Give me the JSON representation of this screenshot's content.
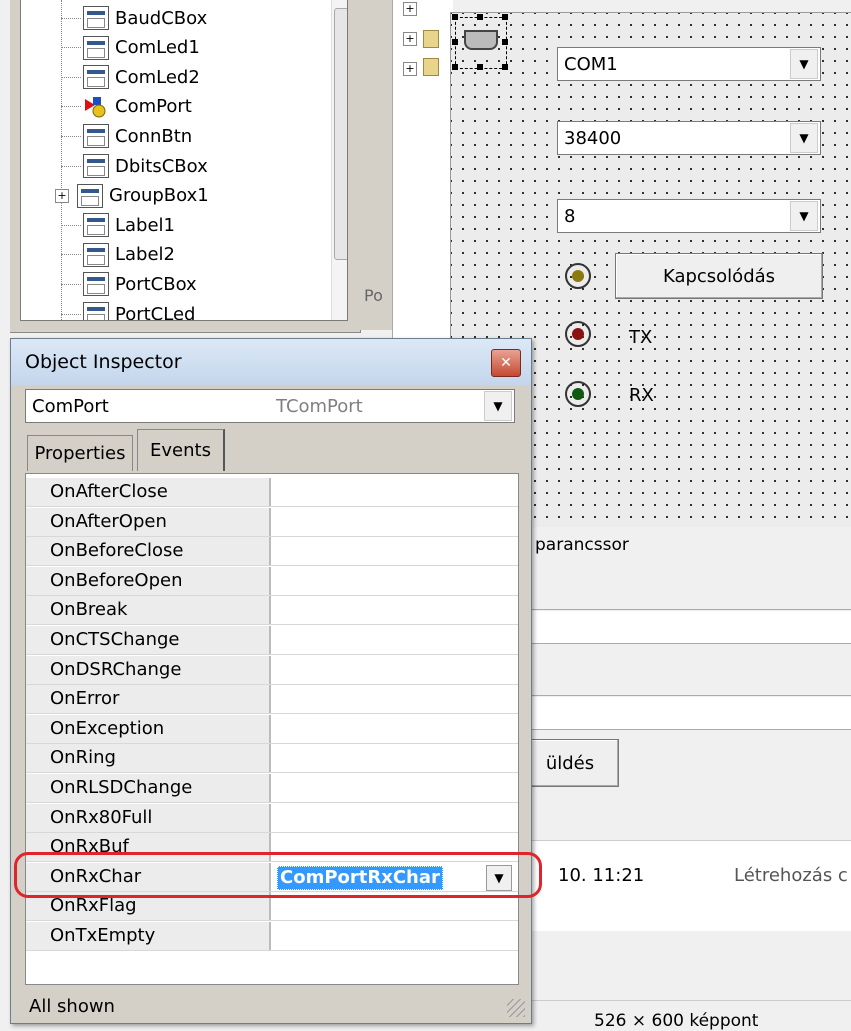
{
  "tree": {
    "items": [
      {
        "label": "BaudCBox",
        "type": "component"
      },
      {
        "label": "ComLed1",
        "type": "component"
      },
      {
        "label": "ComLed2",
        "type": "component"
      },
      {
        "label": "ComPort",
        "type": "comport"
      },
      {
        "label": "ConnBtn",
        "type": "component"
      },
      {
        "label": "DbitsCBox",
        "type": "component"
      },
      {
        "label": "GroupBox1",
        "type": "group",
        "expandable": true
      },
      {
        "label": "Label1",
        "type": "component"
      },
      {
        "label": "Label2",
        "type": "component"
      },
      {
        "label": "PortCBox",
        "type": "component"
      },
      {
        "label": "PortCLed",
        "type": "component"
      }
    ]
  },
  "mid_strip": {
    "partial_label": "Po"
  },
  "designer": {
    "port_combo": "COM1",
    "baud_combo": "38400",
    "bits_combo": "8",
    "connect_button": "Kapcsolódás",
    "tx_label": "TX",
    "rx_label": "RX",
    "partial_caption": "parancssor",
    "send_button_partial": "üldés"
  },
  "file_list": {
    "date_partial": "10. 11:21",
    "type_partial": "Létrehozás c"
  },
  "statusbar": {
    "size_partial": "526 × 600 képpont"
  },
  "object_inspector": {
    "title": "Object Inspector",
    "close_glyph": "✕",
    "selected_component": "ComPort",
    "selected_type": "TComPort",
    "tabs": [
      {
        "label": "Properties",
        "active": false
      },
      {
        "label": "Events",
        "active": true
      }
    ],
    "events": [
      {
        "name": "OnAfterClose",
        "value": ""
      },
      {
        "name": "OnAfterOpen",
        "value": ""
      },
      {
        "name": "OnBeforeClose",
        "value": ""
      },
      {
        "name": "OnBeforeOpen",
        "value": ""
      },
      {
        "name": "OnBreak",
        "value": ""
      },
      {
        "name": "OnCTSChange",
        "value": ""
      },
      {
        "name": "OnDSRChange",
        "value": ""
      },
      {
        "name": "OnError",
        "value": ""
      },
      {
        "name": "OnException",
        "value": ""
      },
      {
        "name": "OnRing",
        "value": ""
      },
      {
        "name": "OnRLSDChange",
        "value": ""
      },
      {
        "name": "OnRx80Full",
        "value": ""
      },
      {
        "name": "OnRxBuf",
        "value": ""
      },
      {
        "name": "OnRxChar",
        "value": "ComPortRxChar",
        "selected": true
      },
      {
        "name": "OnRxFlag",
        "value": ""
      },
      {
        "name": "OnTxEmpty",
        "value": ""
      }
    ],
    "status": "All shown"
  },
  "colors": {
    "selection": "#3399ff",
    "annotation_highlight": "#e0242b",
    "led_yellow": "#8a7a10",
    "led_red": "#8b1010",
    "led_green": "#0f5a0f"
  }
}
